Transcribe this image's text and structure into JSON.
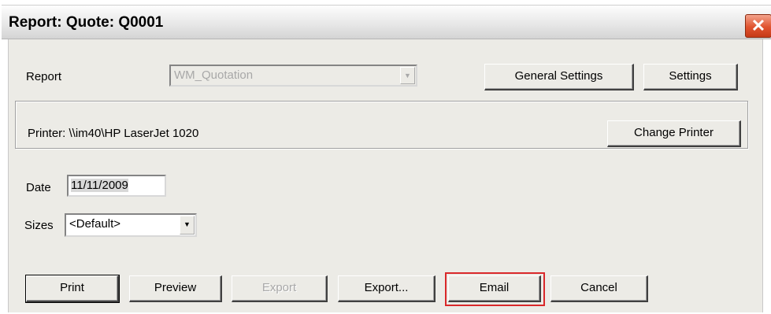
{
  "window": {
    "title": "Report: Quote: Q0001",
    "close_glyph": "✕"
  },
  "report": {
    "label": "Report",
    "selected": "WM_Quotation"
  },
  "buttons": {
    "general_settings": "General Settings",
    "settings": "Settings",
    "change_printer": "Change Printer",
    "print": "Print",
    "preview": "Preview",
    "export_disabled": "Export",
    "export_dots": "Export...",
    "email": "Email",
    "cancel": "Cancel"
  },
  "printer": {
    "text": "Printer: \\\\im40\\HP LaserJet 1020"
  },
  "date": {
    "label": "Date",
    "value": "11/11/2009"
  },
  "sizes": {
    "label": "Sizes",
    "selected": "<Default>"
  },
  "icons": {
    "dropdown": "▼"
  },
  "colors": {
    "dialog_bg": "#ecebe6",
    "highlight": "#d9282a",
    "close_button": "#e0532f"
  }
}
